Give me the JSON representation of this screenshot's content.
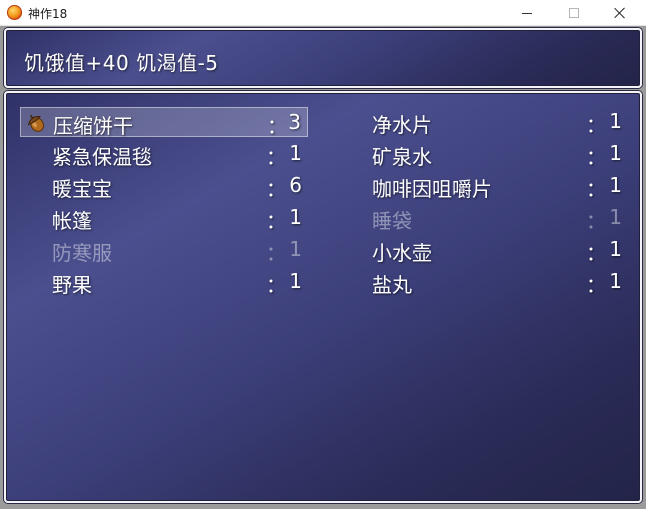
{
  "window": {
    "title": "神作18"
  },
  "help": {
    "text": "饥饿值+40 饥渴值-5"
  },
  "items": [
    {
      "name": "压缩饼干",
      "colon": "：",
      "qty": "3",
      "icon": "acorn-icon",
      "enabled": true,
      "selected": true
    },
    {
      "name": "净水片",
      "colon": "：",
      "qty": "1",
      "enabled": true,
      "selected": false
    },
    {
      "name": "紧急保温毯",
      "colon": "：",
      "qty": "1",
      "enabled": true,
      "selected": false
    },
    {
      "name": "矿泉水",
      "colon": "：",
      "qty": "1",
      "enabled": true,
      "selected": false
    },
    {
      "name": "暖宝宝",
      "colon": "：",
      "qty": "6",
      "enabled": true,
      "selected": false
    },
    {
      "name": "咖啡因咀嚼片",
      "colon": "：",
      "qty": "1",
      "enabled": true,
      "selected": false
    },
    {
      "name": "帐篷",
      "colon": "：",
      "qty": "1",
      "enabled": true,
      "selected": false
    },
    {
      "name": "睡袋",
      "colon": "：",
      "qty": "1",
      "enabled": false,
      "selected": false
    },
    {
      "name": "防寒服",
      "colon": "：",
      "qty": "1",
      "enabled": false,
      "selected": false
    },
    {
      "name": "小水壶",
      "colon": "：",
      "qty": "1",
      "enabled": true,
      "selected": false
    },
    {
      "name": "野果",
      "colon": "：",
      "qty": "1",
      "enabled": true,
      "selected": false
    },
    {
      "name": "盐丸",
      "colon": "：",
      "qty": "1",
      "enabled": true,
      "selected": false
    }
  ],
  "colors": {
    "window_bg_top": "#2f3167",
    "window_bg_mid": "#4b4f8e",
    "window_bg_bottom": "#232448",
    "text": "#ffffff",
    "disabled_text": "#8d8fb0"
  }
}
